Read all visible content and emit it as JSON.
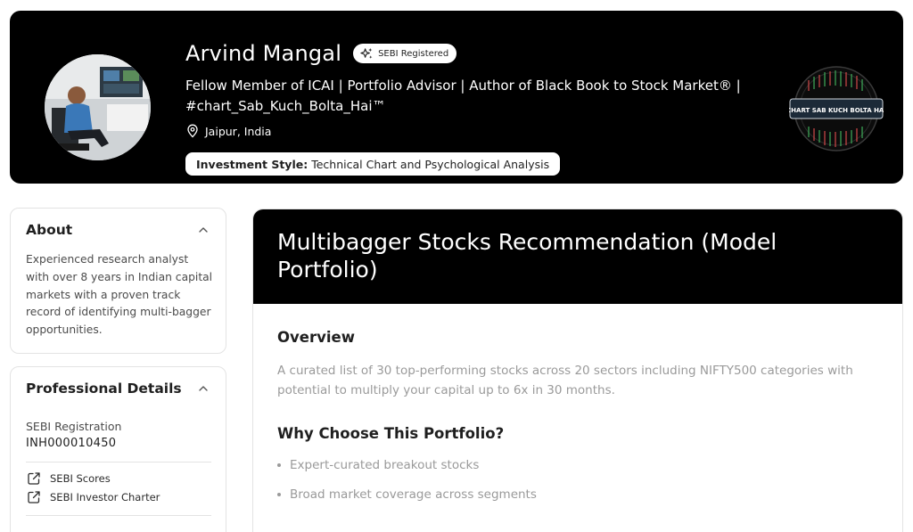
{
  "profile": {
    "name": "Arvind Mangal",
    "badge": "SEBI Registered",
    "tagline": "Fellow Member of ICAI | Portfolio Advisor | Author of Black Book to Stock Market® | #chart_Sab_Kuch_Bolta_Hai™",
    "location": "Jaipur, India",
    "investment_style_label": "Investment Style:",
    "investment_style_value": "Technical Chart and Psychological Analysis",
    "logo_text": "CHART SAB KUCH BOLTA HAI"
  },
  "about": {
    "title": "About",
    "text": "Experienced research analyst with over 8 years in Indian capital markets with a proven track record of identifying multi-bagger opportunities."
  },
  "professional": {
    "title": "Professional Details",
    "registration_label": "SEBI Registration",
    "registration_number": "INH000010450",
    "links": [
      {
        "label": "SEBI Scores",
        "icon": "external-link-icon"
      },
      {
        "label": "SEBI Investor Charter",
        "icon": "external-link-icon"
      }
    ]
  },
  "main": {
    "title": "Multibagger Stocks Recommendation (Model Portfolio)",
    "overview_title": "Overview",
    "overview_text": "A curated list of 30 top-performing stocks across 20 sectors including NIFTY500 categories with potential to multiply your capital up to 6x in 30 months.",
    "why_title": "Why Choose This Portfolio?",
    "bullets": [
      "Expert-curated breakout stocks",
      "Broad market coverage across segments"
    ]
  },
  "colors": {
    "banner_bg": "#000000",
    "text_muted": "#9a9a9a",
    "border": "#e3e3e3"
  }
}
